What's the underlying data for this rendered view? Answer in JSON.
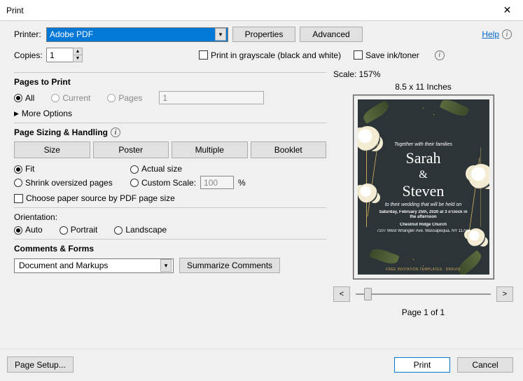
{
  "window": {
    "title": "Print"
  },
  "help_link": "Help",
  "printer": {
    "label": "Printer:",
    "selected": "Adobe PDF",
    "properties_btn": "Properties",
    "advanced_btn": "Advanced"
  },
  "copies": {
    "label": "Copies:",
    "value": "1"
  },
  "options_row": {
    "grayscale": "Print in grayscale (black and white)",
    "save_ink": "Save ink/toner"
  },
  "pages_to_print": {
    "heading": "Pages to Print",
    "all": "All",
    "current": "Current",
    "pages": "Pages",
    "pages_value": "1",
    "more_options": "More Options"
  },
  "sizing": {
    "heading": "Page Sizing & Handling",
    "size": "Size",
    "poster": "Poster",
    "multiple": "Multiple",
    "booklet": "Booklet",
    "fit": "Fit",
    "actual": "Actual size",
    "shrink": "Shrink oversized pages",
    "custom_scale": "Custom Scale:",
    "custom_value": "100",
    "pct": "%",
    "choose_paper": "Choose paper source by PDF page size"
  },
  "orientation": {
    "heading": "Orientation:",
    "auto": "Auto",
    "portrait": "Portrait",
    "landscape": "Landscape"
  },
  "comments": {
    "heading": "Comments & Forms",
    "selected": "Document and Markups",
    "summarize": "Summarize Comments"
  },
  "preview": {
    "scale": "Scale: 157%",
    "paper": "8.5 x 11 Inches",
    "page_of": "Page 1 of 1",
    "invite": {
      "top": "Together with their families",
      "name1": "Sarah",
      "amp": "&",
      "name2": "Steven",
      "line1": "to their wedding that will be held on",
      "line2": "Saturday, February 25th, 2020 at 3 o'clock in the afternoon",
      "venue": "Chestnut Ridge Church",
      "addr": "7107 West Wrangler Ave. Massapequa, NY 11758",
      "footer": "FREE INVITATION TEMPLATES · DREVIO"
    }
  },
  "footer": {
    "page_setup": "Page Setup...",
    "print": "Print",
    "cancel": "Cancel"
  }
}
